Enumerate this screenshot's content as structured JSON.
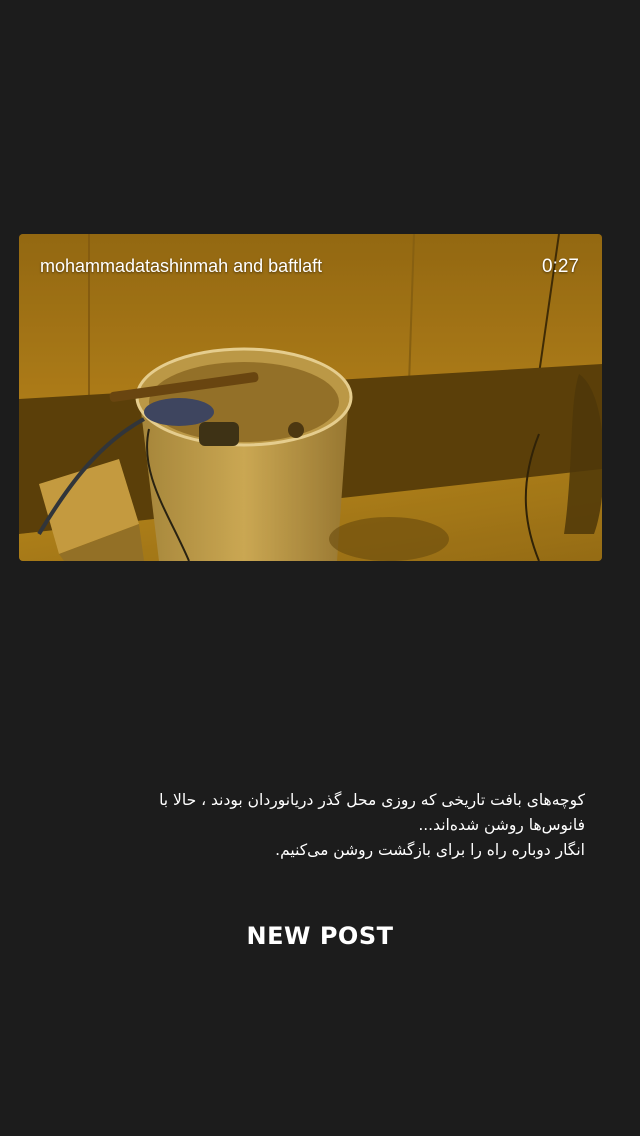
{
  "video": {
    "author_line": "mohammadatashinmah and baftlaft",
    "duration": "0:27"
  },
  "caption": {
    "lines": [
      "کوچه‌های بافت تاریخی که روزی محل گذر دریانوردان بودند ، حالا با",
      "فانوس‌ها روشن شده‌اند...",
      "انگار دوباره راه را برای بازگشت روشن می‌کنیم."
    ]
  },
  "sticker": {
    "label": "NEW POST"
  },
  "colors": {
    "background": "#1c1c1c",
    "text": "#ffffff",
    "video_tint": "#b8860b"
  }
}
